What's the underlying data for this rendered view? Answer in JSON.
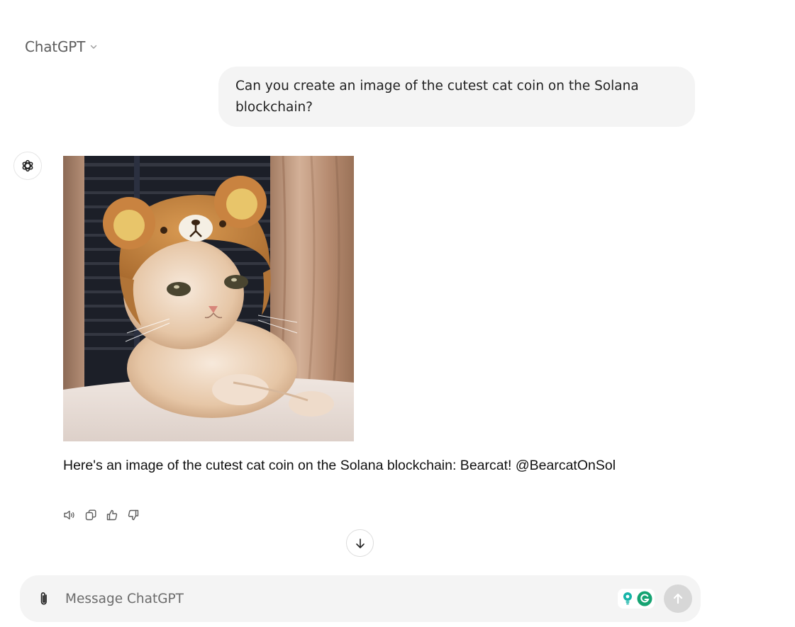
{
  "header": {
    "model_name": "ChatGPT"
  },
  "conversation": {
    "user_message": "Can you create an image of the cutest cat coin on the Solana blockchain?",
    "assistant_message": "Here's an image of the cutest cat coin on the Solana blockchain: Bearcat! @BearcatOnSol"
  },
  "composer": {
    "placeholder": "Message ChatGPT",
    "value": ""
  },
  "icons": {
    "model_dropdown": "chevron-down-icon",
    "assistant_avatar": "openai-logo-icon",
    "read_aloud": "speaker-icon",
    "copy": "copy-icon",
    "thumbs_up": "thumbs-up-icon",
    "thumbs_down": "thumbs-down-icon",
    "scroll_down": "arrow-down-icon",
    "attach": "paperclip-icon",
    "send": "arrow-up-icon",
    "extensions": [
      "lightbulb-extension-icon",
      "grammarly-icon"
    ]
  },
  "colors": {
    "bubble_bg": "#f4f4f4",
    "send_disabled": "#d7d7d7",
    "grammarly_green": "#15c39a"
  }
}
